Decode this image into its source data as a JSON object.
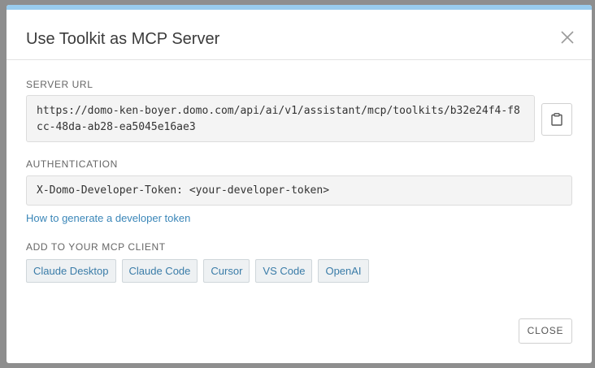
{
  "dialog": {
    "title": "Use Toolkit as MCP Server",
    "close_icon": "close-icon",
    "close_label": "CLOSE"
  },
  "server_url": {
    "label": "SERVER URL",
    "value": "https://domo-ken-boyer.domo.com/api/ai/v1/assistant/mcp/toolkits/b32e24f4-f8cc-48da-ab28-ea5045e16ae3",
    "copy_icon": "clipboard-icon"
  },
  "authentication": {
    "label": "AUTHENTICATION",
    "value": "X-Domo-Developer-Token: <your-developer-token>",
    "help_link": "How to generate a developer token"
  },
  "mcp_client": {
    "label": "ADD TO YOUR MCP CLIENT",
    "options": [
      "Claude Desktop",
      "Claude Code",
      "Cursor",
      "VS Code",
      "OpenAI"
    ]
  },
  "colors": {
    "accent_bar": "#99ccee",
    "link": "#3a86b8",
    "client_button_text": "#3a7ca8"
  }
}
